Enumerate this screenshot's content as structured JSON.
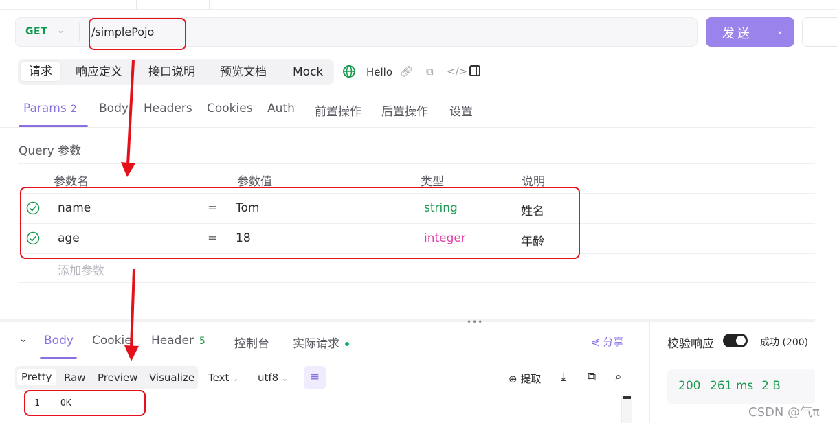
{
  "request": {
    "method": "GET",
    "url": "/simplePojo",
    "send_label": "发送"
  },
  "request_tabs": [
    {
      "label": "请求",
      "active": true
    },
    {
      "label": "响应定义"
    },
    {
      "label": "接口说明"
    },
    {
      "label": "预览文档"
    },
    {
      "label": "Mock"
    }
  ],
  "env": {
    "name": "Hello"
  },
  "param_tabs": [
    {
      "label": "Params",
      "badge": "2",
      "active": true
    },
    {
      "label": "Body"
    },
    {
      "label": "Headers"
    },
    {
      "label": "Cookies"
    },
    {
      "label": "Auth"
    },
    {
      "label": "前置操作"
    },
    {
      "label": "后置操作"
    },
    {
      "label": "设置"
    }
  ],
  "query": {
    "title": "Query 参数",
    "columns": [
      "参数名",
      "参数值",
      "类型",
      "说明"
    ],
    "rows": [
      {
        "name": "name",
        "eq": "=",
        "value": "Tom",
        "type": "string",
        "desc": "姓名"
      },
      {
        "name": "age",
        "eq": "=",
        "value": "18",
        "type": "integer",
        "desc": "年龄"
      }
    ],
    "add_placeholder": "添加参数"
  },
  "response_tabs": [
    {
      "label": "Body",
      "active": true
    },
    {
      "label": "Cookie"
    },
    {
      "label": "Header",
      "badge": "5"
    },
    {
      "label": "控制台"
    },
    {
      "label": "实际请求"
    }
  ],
  "share_label": "分享",
  "validate": {
    "label": "校验响应",
    "status": "成功 (200)"
  },
  "view_modes": [
    "Pretty",
    "Raw",
    "Preview",
    "Visualize"
  ],
  "format_select": "Text",
  "encoding_select": "utf8",
  "extract_label": "提取",
  "code": [
    {
      "line": "1",
      "text": "OK"
    }
  ],
  "stats": {
    "status": "200",
    "time": "261 ms",
    "size": "2 B"
  },
  "watermark": "CSDN @气π"
}
